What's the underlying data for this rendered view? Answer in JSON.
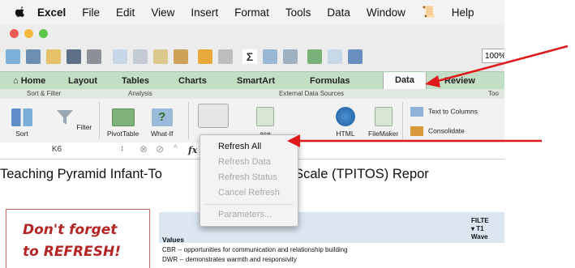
{
  "menubar": {
    "app_name": "Excel",
    "items": [
      "File",
      "Edit",
      "View",
      "Insert",
      "Format",
      "Tools",
      "Data",
      "Window"
    ],
    "help": "Help"
  },
  "toolbar": {
    "zoom": "100%"
  },
  "ribbon": {
    "tabs": [
      "Home",
      "Layout",
      "Tables",
      "Charts",
      "SmartArt",
      "Formulas",
      "Data",
      "Review"
    ],
    "active_tab": "Data",
    "groups": [
      "Sort & Filter",
      "Analysis",
      "External Data Sources",
      "Too"
    ],
    "buttons": {
      "sort": "Sort",
      "filter": "Filter",
      "pivottable": "PivotTable",
      "whatif": "What-If",
      "database": "ase",
      "html": "HTML",
      "filemaker": "FileMaker",
      "text_to_columns": "Text to Columns",
      "consolidate": "Consolidate"
    }
  },
  "formula_bar": {
    "cell_ref": "K6",
    "fx": "fx"
  },
  "sheet": {
    "heading": "Teaching Pyramid Infant-To",
    "heading_right": "tion Scale (TPITOS) Repor",
    "reminder_line1": "Don't forget",
    "reminder_line2": "to REFRESH!",
    "values_label": "Values",
    "filter_label": "FILTE",
    "filter_t1": "T1",
    "wave_label": "Wave",
    "rows": [
      "CBR -- opportunities for communication and relationship building",
      "DWR --  demonstrates warmth and responsivity"
    ]
  },
  "dropdown": {
    "items": [
      {
        "label": "Refresh All",
        "enabled": true
      },
      {
        "label": "Refresh Data",
        "enabled": false
      },
      {
        "label": "Refresh Status",
        "enabled": false
      },
      {
        "label": "Cancel Refresh",
        "enabled": false
      },
      {
        "label": "Parameters...",
        "enabled": false
      }
    ]
  },
  "colors": {
    "ribbon_tab_bar": "#c2dfc5",
    "annotation_arrow": "#e0191b",
    "reminder_text": "#b62525",
    "table_header": "#dce6f1"
  }
}
